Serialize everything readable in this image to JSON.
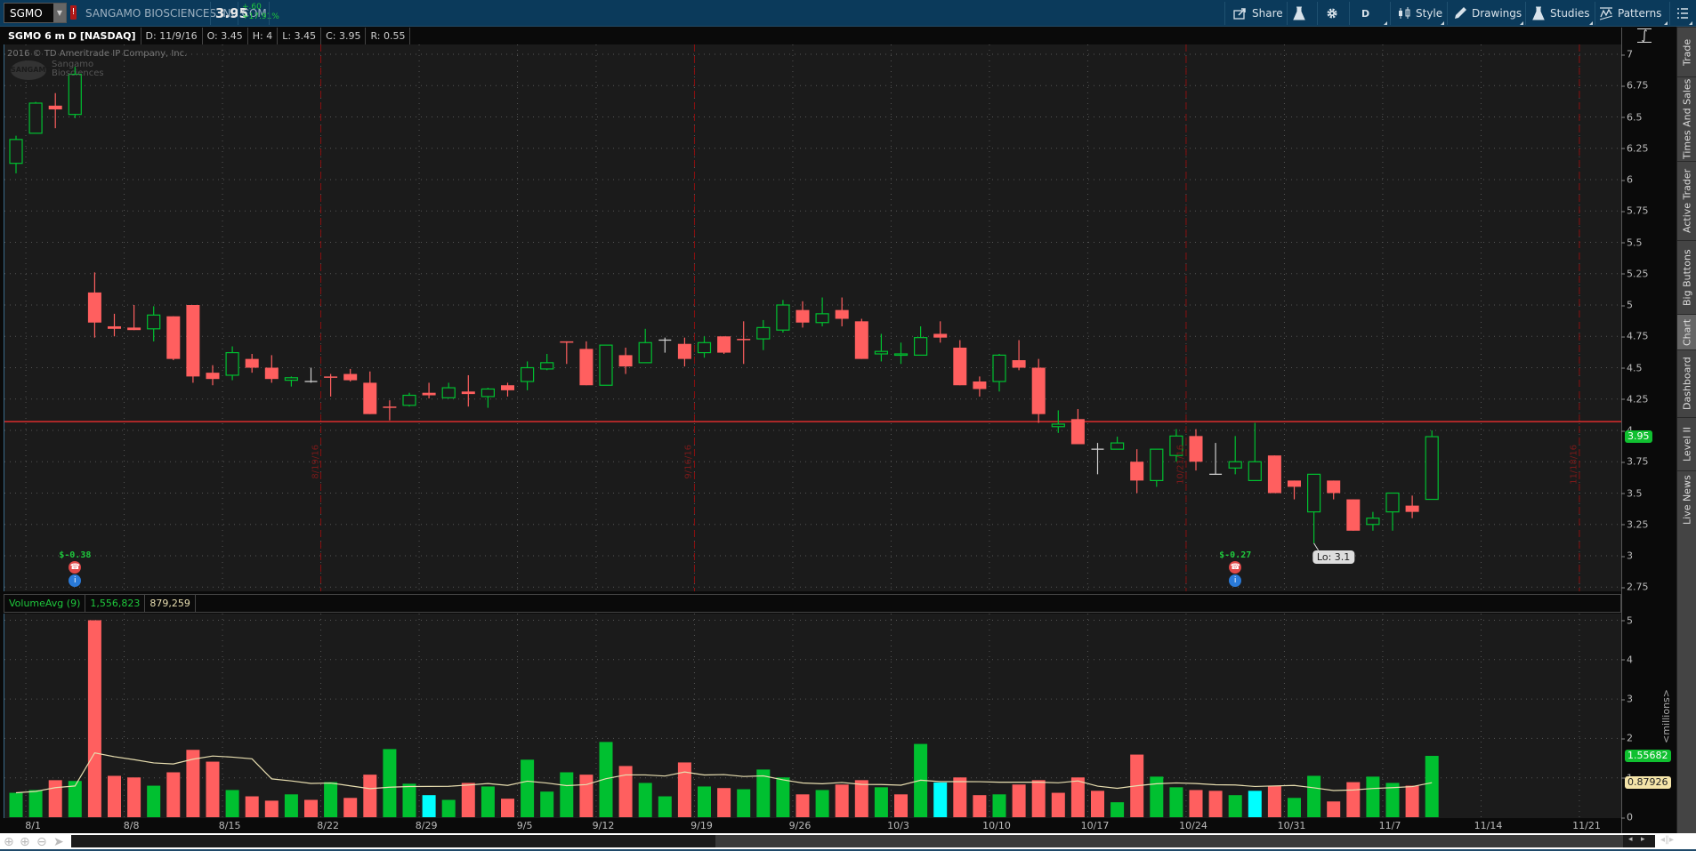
{
  "toolbar": {
    "symbol": "SGMO",
    "alert_badge": "!",
    "company": "SANGAMO BIOSCIENCES INC COM",
    "last": "3.95",
    "change": "+.60",
    "change_pct": "+17.91%",
    "share": "Share",
    "aggregation": "D",
    "style": "Style",
    "drawings": "Drawings",
    "studies": "Studies",
    "patterns": "Patterns"
  },
  "info_bar": {
    "title": "SGMO 6 m D [NASDAQ]",
    "date": "D: 11/9/16",
    "open": "O: 3.45",
    "high": "H: 4",
    "low": "L: 3.45",
    "close": "C: 3.95",
    "range": "R: 0.55"
  },
  "watermark": {
    "copyright": "2016 © TD Ameritrade IP Company, Inc.",
    "logo_line1": "Sangamo",
    "logo_line2": "Biosciences",
    "seal": "SANGAMO"
  },
  "volume_header": {
    "label": "VolumeAvg (9)",
    "volume": "1,556,823",
    "avg": "879,259"
  },
  "side_tabs": [
    "Trade",
    "Times And Sales",
    "Active Trader",
    "Big Buttons",
    "Chart",
    "Dashboard",
    "Level II",
    "Live News"
  ],
  "active_tab": "Chart",
  "colors": {
    "up": "#00c030",
    "down": "#ff5f5f",
    "neutral": "#cccccc",
    "cyan": "#00ffff",
    "avg": "#e8deb0",
    "hline": "#ff3030"
  },
  "chart_data": {
    "type": "candlestick",
    "title": "SGMO 6 m D [NASDAQ]",
    "ohlc": [
      [
        6.13,
        6.35,
        6.05,
        6.32
      ],
      [
        6.37,
        6.62,
        6.37,
        6.61
      ],
      [
        6.59,
        6.69,
        6.41,
        6.56
      ],
      [
        6.52,
        6.9,
        6.49,
        6.84
      ],
      [
        5.1,
        5.26,
        4.74,
        4.86
      ],
      [
        4.83,
        4.93,
        4.75,
        4.81
      ],
      [
        4.82,
        5.0,
        4.8,
        4.8
      ],
      [
        4.81,
        4.99,
        4.71,
        4.92
      ],
      [
        4.91,
        4.91,
        4.56,
        4.57
      ],
      [
        5.0,
        5.0,
        4.38,
        4.43
      ],
      [
        4.46,
        4.52,
        4.36,
        4.41
      ],
      [
        4.44,
        4.67,
        4.4,
        4.62
      ],
      [
        4.57,
        4.61,
        4.46,
        4.5
      ],
      [
        4.5,
        4.6,
        4.38,
        4.41
      ],
      [
        4.4,
        4.43,
        4.35,
        4.42
      ],
      [
        4.39,
        4.5,
        4.38,
        4.39
      ],
      [
        4.43,
        4.45,
        4.27,
        4.42
      ],
      [
        4.45,
        4.49,
        4.39,
        4.4
      ],
      [
        4.38,
        4.47,
        4.13,
        4.13
      ],
      [
        4.19,
        4.24,
        4.08,
        4.18
      ],
      [
        4.2,
        4.3,
        4.19,
        4.28
      ],
      [
        4.3,
        4.38,
        4.255,
        4.28
      ],
      [
        4.26,
        4.38,
        4.255,
        4.34
      ],
      [
        4.31,
        4.44,
        4.19,
        4.29
      ],
      [
        4.27,
        4.34,
        4.18,
        4.33
      ],
      [
        4.36,
        4.38,
        4.27,
        4.32
      ],
      [
        4.39,
        4.55,
        4.32,
        4.5
      ],
      [
        4.49,
        4.61,
        4.48,
        4.54
      ],
      [
        4.71,
        4.71,
        4.53,
        4.7
      ],
      [
        4.65,
        4.71,
        4.36,
        4.36
      ],
      [
        4.36,
        4.68,
        4.36,
        4.68
      ],
      [
        4.6,
        4.66,
        4.45,
        4.51
      ],
      [
        4.54,
        4.81,
        4.54,
        4.7
      ],
      [
        4.72,
        4.74,
        4.62,
        4.72
      ],
      [
        4.69,
        4.74,
        4.51,
        4.57
      ],
      [
        4.62,
        4.75,
        4.58,
        4.7
      ],
      [
        4.75,
        4.75,
        4.61,
        4.62
      ],
      [
        4.73,
        4.87,
        4.53,
        4.72
      ],
      [
        4.73,
        4.88,
        4.64,
        4.82
      ],
      [
        4.8,
        5.04,
        4.78,
        5.0
      ],
      [
        4.96,
        5.03,
        4.82,
        4.86
      ],
      [
        4.86,
        5.06,
        4.83,
        4.93
      ],
      [
        4.96,
        5.06,
        4.83,
        4.89
      ],
      [
        4.87,
        4.89,
        4.57,
        4.57
      ],
      [
        4.61,
        4.77,
        4.55,
        4.63
      ],
      [
        4.6,
        4.7,
        4.53,
        4.61
      ],
      [
        4.6,
        4.83,
        4.6,
        4.74
      ],
      [
        4.77,
        4.87,
        4.7,
        4.74
      ],
      [
        4.66,
        4.72,
        4.36,
        4.36
      ],
      [
        4.39,
        4.43,
        4.27,
        4.33
      ],
      [
        4.39,
        4.61,
        4.31,
        4.6
      ],
      [
        4.56,
        4.72,
        4.48,
        4.5
      ],
      [
        4.5,
        4.57,
        4.06,
        4.13
      ],
      [
        4.03,
        4.16,
        3.98,
        4.05
      ],
      [
        4.09,
        4.17,
        3.89,
        3.89
      ],
      [
        3.85,
        3.9,
        3.65,
        3.85
      ],
      [
        3.85,
        3.95,
        3.85,
        3.9
      ],
      [
        3.75,
        3.85,
        3.5,
        3.6
      ],
      [
        3.6,
        3.85,
        3.55,
        3.85
      ],
      [
        3.8,
        4.01,
        3.75,
        3.955
      ],
      [
        3.955,
        4.01,
        3.68,
        3.75
      ],
      [
        3.65,
        3.9,
        3.65,
        3.65
      ],
      [
        3.7,
        3.955,
        3.65,
        3.75
      ],
      [
        3.6,
        4.06,
        3.6,
        3.75
      ],
      [
        3.8,
        3.8,
        3.5,
        3.5
      ],
      [
        3.6,
        3.6,
        3.45,
        3.55
      ],
      [
        3.35,
        3.65,
        3.1,
        3.65
      ],
      [
        3.6,
        3.6,
        3.45,
        3.5
      ],
      [
        3.45,
        3.45,
        3.2,
        3.2
      ],
      [
        3.25,
        3.35,
        3.2,
        3.3
      ],
      [
        3.35,
        3.5,
        3.2,
        3.5
      ],
      [
        3.4,
        3.48,
        3.3,
        3.35
      ],
      [
        3.45,
        4.0,
        3.45,
        3.95
      ]
    ],
    "volume_millions": [
      0.62,
      0.69,
      0.94,
      0.92,
      5.0,
      1.05,
      1.01,
      0.8,
      1.14,
      1.71,
      1.41,
      0.69,
      0.53,
      0.42,
      0.58,
      0.44,
      0.89,
      0.49,
      1.08,
      1.73,
      0.85,
      0.56,
      0.44,
      0.87,
      0.78,
      0.47,
      1.46,
      0.65,
      1.14,
      1.08,
      1.91,
      1.3,
      0.87,
      0.53,
      1.39,
      0.78,
      0.74,
      0.71,
      1.21,
      1.01,
      0.58,
      0.69,
      0.83,
      0.94,
      0.76,
      0.58,
      1.86,
      0.88,
      1.01,
      0.56,
      0.58,
      0.83,
      0.94,
      0.62,
      1.01,
      0.67,
      0.38,
      1.59,
      1.03,
      0.76,
      0.69,
      0.67,
      0.56,
      0.67,
      0.8,
      0.49,
      1.05,
      0.4,
      0.89,
      1.03,
      0.87,
      0.8,
      1.557
    ],
    "volume_colors": "ggrgrrrgrrrgrrgrgrrggcgrgrgggrgrggrgrgggrgrrgrgcrrgrrrrrgrggrrgcrggrrggrg",
    "volume_avg_period": 9,
    "price_range": [
      2.75,
      7
    ],
    "price_ticks": [
      "7",
      "6.75",
      "6.5",
      "6.25",
      "6",
      "5.75",
      "5.5",
      "5.25",
      "5",
      "4.75",
      "4.5",
      "4.25",
      "4",
      "3.75",
      "3.5",
      "3.25",
      "3",
      "2.75"
    ],
    "volume_range": [
      0,
      5
    ],
    "volume_ticks": [
      "5",
      "4",
      "3",
      "2",
      "1",
      "0"
    ],
    "volume_unit": "<millions>",
    "x_ticks": [
      {
        "label": "8/1",
        "index": 1
      },
      {
        "label": "8/8",
        "index": 6
      },
      {
        "label": "8/15",
        "index": 11
      },
      {
        "label": "8/22",
        "index": 16
      },
      {
        "label": "8/29",
        "index": 21
      },
      {
        "label": "9/5",
        "index": 26
      },
      {
        "label": "9/12",
        "index": 30
      },
      {
        "label": "9/19",
        "index": 35
      },
      {
        "label": "9/26",
        "index": 40
      },
      {
        "label": "10/3",
        "index": 45
      },
      {
        "label": "10/10",
        "index": 50
      },
      {
        "label": "10/17",
        "index": 55
      },
      {
        "label": "10/24",
        "index": 60
      },
      {
        "label": "10/31",
        "index": 65
      },
      {
        "label": "11/7",
        "index": 70
      },
      {
        "label": "11/14",
        "index": 75
      },
      {
        "label": "11/21",
        "index": 80
      }
    ],
    "expiry_lines": [
      {
        "label": "8/19/16",
        "index": 15.5
      },
      {
        "label": "9/16/16",
        "index": 34.5
      },
      {
        "label": "10/21/16",
        "index": 59.5
      },
      {
        "label": "11/18/16",
        "index": 79.5
      }
    ],
    "price_line": 4.07,
    "last_badge": "3.95",
    "volume_badge": "1.55682",
    "volume_avg_badge": "0.87926",
    "earnings": [
      {
        "label": "$-0.38",
        "index": 3
      },
      {
        "label": "$-0.27",
        "index": 62
      }
    ],
    "low_tooltip": {
      "label": "Lo: 3.1",
      "index": 66,
      "price": 3.1
    }
  }
}
